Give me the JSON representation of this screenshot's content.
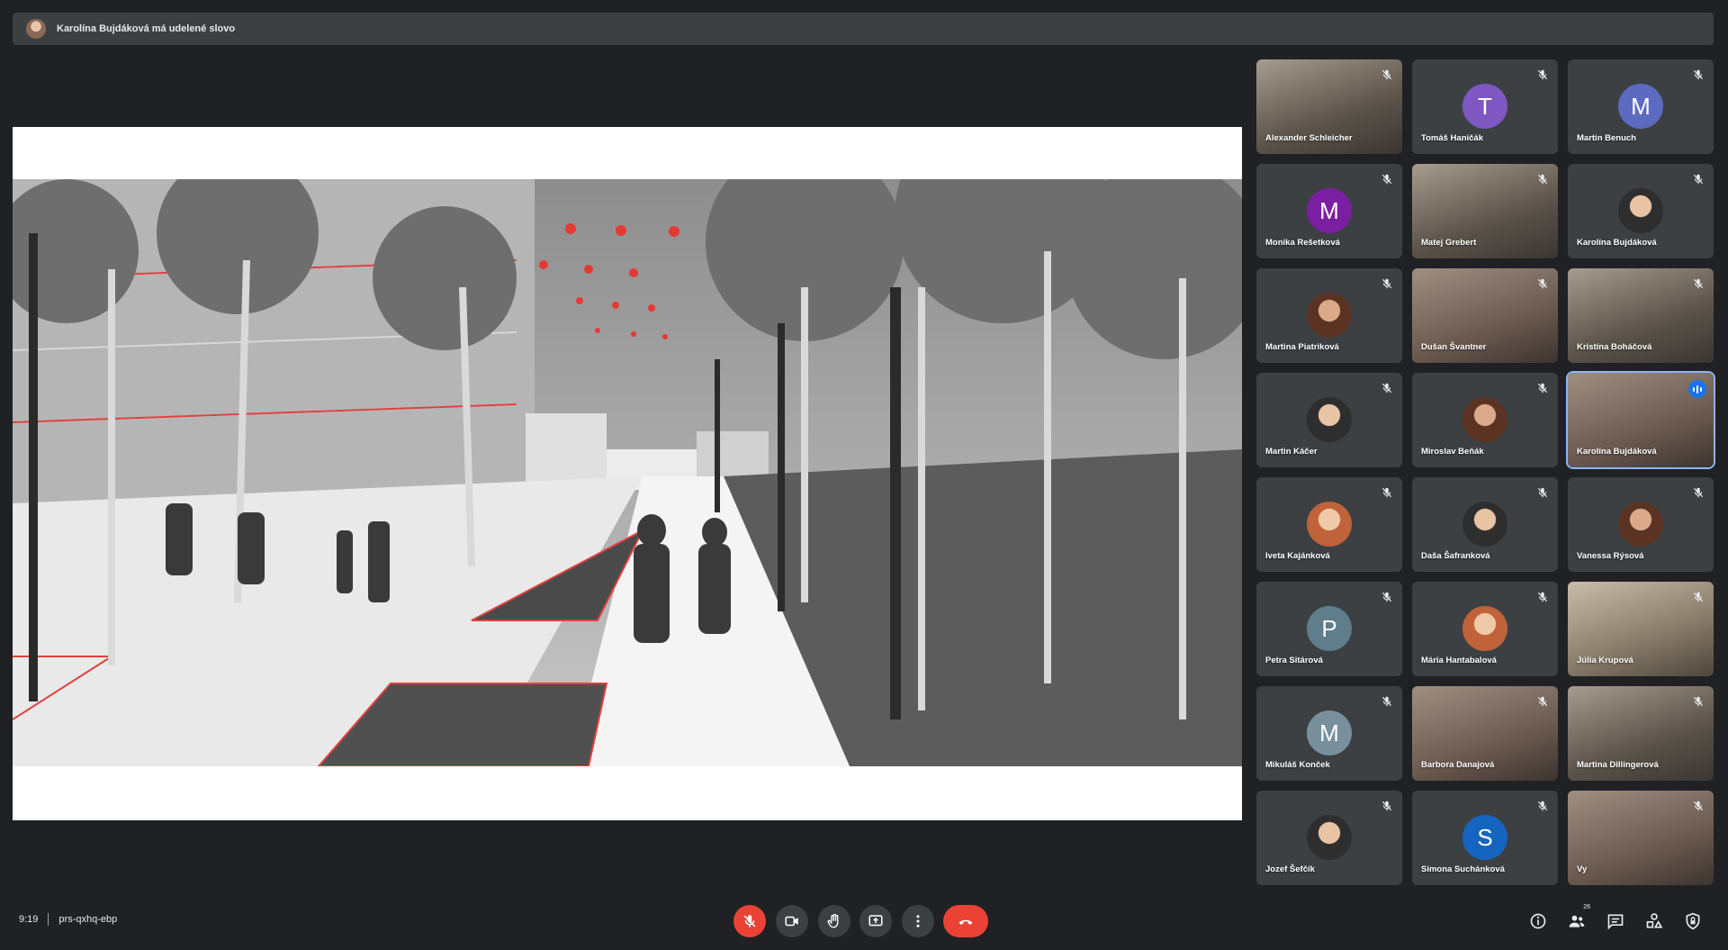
{
  "banner": {
    "text": "Karolína Bujdáková má udelené slovo"
  },
  "participants": [
    {
      "name": "Alexander Schleicher",
      "type": "video"
    },
    {
      "name": "Tomáš Haničák",
      "type": "initial",
      "initial": "T",
      "color": "#7e57c2"
    },
    {
      "name": "Martin Benuch",
      "type": "initial",
      "initial": "M",
      "color": "#5c6bc0"
    },
    {
      "name": "Monika Rešetková",
      "type": "initial",
      "initial": "M",
      "color": "#7b1fa2"
    },
    {
      "name": "Matej Grebert",
      "type": "video"
    },
    {
      "name": "Karolína Bujdáková",
      "type": "photo"
    },
    {
      "name": "Martina Piatriková",
      "type": "photo"
    },
    {
      "name": "Dušan Švantner",
      "type": "video"
    },
    {
      "name": "Kristína Boháčová",
      "type": "video"
    },
    {
      "name": "Martin Káčer",
      "type": "photo"
    },
    {
      "name": "Miroslav Beňák",
      "type": "photo"
    },
    {
      "name": "Karolína Bujdáková",
      "type": "video",
      "speaking": true
    },
    {
      "name": "Iveta Kajánková",
      "type": "photo"
    },
    {
      "name": "Daša Šafranková",
      "type": "photo"
    },
    {
      "name": "Vanessa Rýsová",
      "type": "photo"
    },
    {
      "name": "Petra Sitárová",
      "type": "initial",
      "initial": "P",
      "color": "#607d8b"
    },
    {
      "name": "Mária Hantabalová",
      "type": "photo"
    },
    {
      "name": "Júlia Krupová",
      "type": "video"
    },
    {
      "name": "Mikuláš Konček",
      "type": "initial",
      "initial": "M",
      "color": "#78909c"
    },
    {
      "name": "Barbora Danajová",
      "type": "video"
    },
    {
      "name": "Martina Dillingerová",
      "type": "video"
    },
    {
      "name": "Jozef Šefčík",
      "type": "photo"
    },
    {
      "name": "Simona Suchánková",
      "type": "initial",
      "initial": "S",
      "color": "#1565c0"
    },
    {
      "name": "Vy",
      "type": "video"
    }
  ],
  "bottom_bar": {
    "time": "9:19",
    "meeting_code": "prs-qxhq-ebp",
    "participant_count": "26",
    "icons": [
      "mic-off-icon",
      "camera-icon",
      "raise-hand-icon",
      "present-screen-icon",
      "more-options-icon",
      "hang-up-icon",
      "info-icon",
      "people-icon",
      "chat-icon",
      "activities-icon",
      "host-controls-icon"
    ]
  },
  "colors": {
    "background": "#202124",
    "tile": "#3c4043",
    "danger": "#ea4335",
    "speaking": "#1a73e8"
  }
}
